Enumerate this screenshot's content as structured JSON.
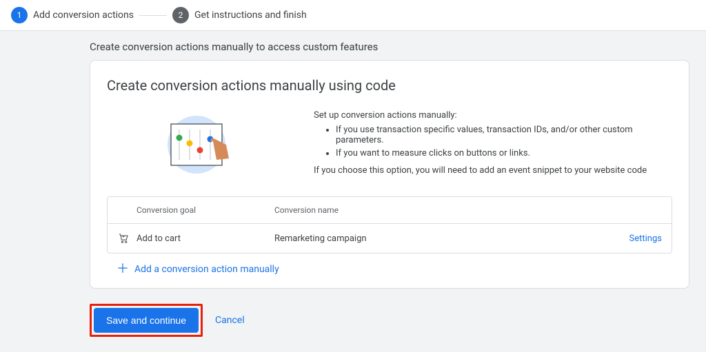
{
  "stepper": {
    "step1": {
      "num": "1",
      "label": "Add conversion actions"
    },
    "step2": {
      "num": "2",
      "label": "Get instructions and finish"
    }
  },
  "section_title": "Create conversion actions manually to access custom features",
  "card": {
    "title": "Create conversion actions manually using code",
    "intro_lead": "Set up conversion actions manually:",
    "bullets": [
      "If you use transaction specific values, transaction IDs, and/or other custom parameters.",
      "If you want to measure clicks on buttons or links."
    ],
    "intro_tail": "If you choose this option, you will need to add an event snippet to your website code"
  },
  "table": {
    "headers": {
      "goal": "Conversion goal",
      "name": "Conversion name"
    },
    "row": {
      "goal": "Add to cart",
      "name": "Remarketing campaign",
      "settings": "Settings"
    }
  },
  "add_action_label": "Add a conversion action manually",
  "footer": {
    "save": "Save and continue",
    "cancel": "Cancel"
  }
}
